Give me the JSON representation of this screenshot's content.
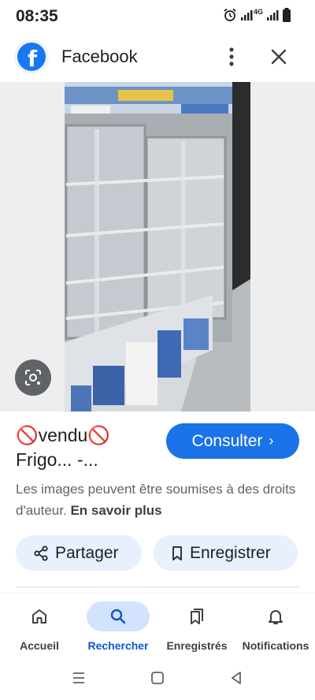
{
  "status_bar": {
    "time": "08:35",
    "network_label": "4G",
    "icons": [
      "alarm-icon",
      "signal-icon",
      "signal-icon",
      "battery-icon"
    ]
  },
  "app_bar": {
    "logo_letter": "f",
    "title": "Facebook",
    "icons": [
      "more-vert-icon",
      "close-icon"
    ]
  },
  "image": {
    "description_icon": "google-lens-icon"
  },
  "result": {
    "title_line1": "🚫vendu🚫",
    "title_line2": "Frigo... -...",
    "consult_label": "Consulter",
    "consult_chevron": "›",
    "copyright_text": "Les images peuvent être soumises à des droits d'auteur.",
    "copyright_link": "En savoir plus"
  },
  "actions": {
    "share_label": "Partager",
    "save_label": "Enregistrer"
  },
  "bottom_nav": {
    "items": [
      {
        "label": "Accueil",
        "icon": "home-icon",
        "active": false
      },
      {
        "label": "Rechercher",
        "icon": "search-icon",
        "active": true
      },
      {
        "label": "Enregistrés",
        "icon": "bookmarks-icon",
        "active": false
      },
      {
        "label": "Notifications",
        "icon": "bell-icon",
        "active": false
      }
    ]
  },
  "colors": {
    "accent": "#1a73e8",
    "facebook_blue": "#1877f2",
    "pill_bg": "#e8f0fe",
    "active_nav_bg": "#d3e3fd"
  }
}
